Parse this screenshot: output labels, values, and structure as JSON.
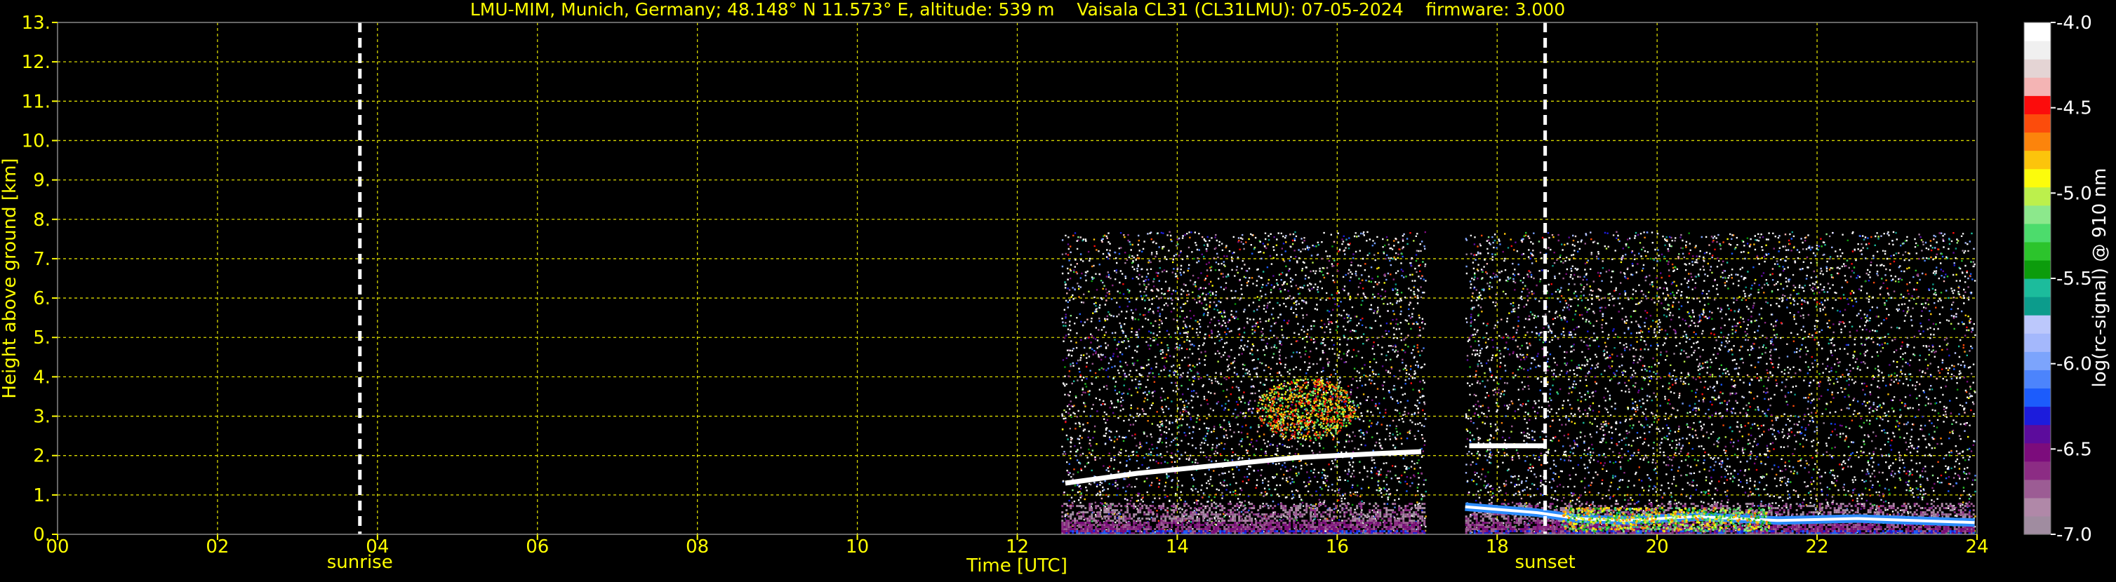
{
  "chart_data": {
    "type": "heatmap",
    "title": "LMU-MIM, Munich, Germany; 48.148° N 11.573° E, altitude: 539 m    Vaisala CL31 (CL31LMU): 07-05-2024    firmware: 3.000",
    "xlabel": "Time [UTC]",
    "ylabel": "Height above ground [km]",
    "xlim": [
      0,
      24
    ],
    "ylim": [
      0,
      13
    ],
    "x_ticks": [
      "00",
      "02",
      "04",
      "06",
      "08",
      "10",
      "12",
      "14",
      "16",
      "18",
      "20",
      "22",
      "24"
    ],
    "y_ticks": [
      "0.",
      "1.",
      "2.",
      "3.",
      "4.",
      "5.",
      "6.",
      "7.",
      "8.",
      "9.",
      "10.",
      "11.",
      "12.",
      "13."
    ],
    "grid": true,
    "colorbar": {
      "label": "log(rc-signal) @ 910 nm",
      "range": [
        -7.0,
        -4.0
      ],
      "ticks": [
        "-4.0",
        "-4.5",
        "-5.0",
        "-5.5",
        "-6.0",
        "-6.5",
        "-7.0"
      ],
      "colors": [
        "#a08ca0",
        "#b088a8",
        "#9c5c94",
        "#8c2c84",
        "#7c0c7c",
        "#5c0c9c",
        "#1c1cdc",
        "#1c5cfc",
        "#4c84fc",
        "#7ca4fc",
        "#a4b8fc",
        "#bcc8fc",
        "#0c9c8c",
        "#1cbc9c",
        "#0c9c0c",
        "#2cc42c",
        "#4cdc6c",
        "#8ce88c",
        "#bcf04c",
        "#fcfc0c",
        "#fcc40c",
        "#fc840c",
        "#fc4c0c",
        "#fc0c0c",
        "#f4b4b4",
        "#e4d4d4",
        "#f0f0f0",
        "#ffffff"
      ]
    },
    "events": [
      {
        "label": "sunrise",
        "time": 3.78
      },
      {
        "label": "sunset",
        "time": 18.6
      }
    ],
    "data_segments": [
      {
        "start": 12.55,
        "end": 17.1,
        "max_height": 7.7
      },
      {
        "start": 17.6,
        "end": 23.97,
        "max_height": 7.7
      }
    ],
    "features": {
      "cloud_layer": [
        {
          "time": 12.6,
          "height": 1.3
        },
        {
          "time": 13.5,
          "height": 1.55
        },
        {
          "time": 14.5,
          "height": 1.75
        },
        {
          "time": 15.5,
          "height": 1.95
        },
        {
          "time": 16.5,
          "height": 2.05
        },
        {
          "time": 17.05,
          "height": 2.1
        },
        {
          "time": 17.65,
          "height": 2.25
        },
        {
          "time": 18.6,
          "height": 2.25
        }
      ],
      "aerosol_plume": {
        "time": 15.6,
        "height": 3.2
      },
      "boundary_layer": [
        {
          "time": 17.6,
          "height": 0.7
        },
        {
          "time": 18.5,
          "height": 0.55
        },
        {
          "time": 19.0,
          "height": 0.4
        },
        {
          "time": 19.6,
          "height": 0.35
        },
        {
          "time": 20.5,
          "height": 0.45
        },
        {
          "time": 21.5,
          "height": 0.35
        },
        {
          "time": 22.5,
          "height": 0.4
        },
        {
          "time": 23.97,
          "height": 0.3
        }
      ]
    }
  },
  "colors": {
    "axis": "#ffff00",
    "grid": "#d8d800",
    "event_line": "#ffffff",
    "background": "#000000"
  }
}
